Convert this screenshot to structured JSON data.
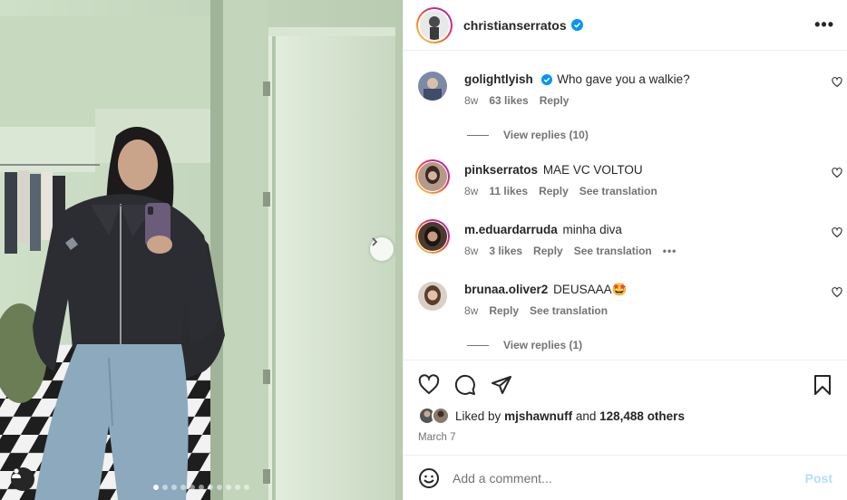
{
  "post": {
    "author": "christianserratos",
    "verified": true,
    "more_label": "•••"
  },
  "comments": [
    {
      "user": "golightlyish",
      "verified": true,
      "text": "Who gave you a walkie?",
      "age": "8w",
      "likes": "63 likes",
      "reply": "Reply",
      "translate": ""
    },
    {
      "user": "pinkserratos",
      "verified": false,
      "text": "MAE VC VOLTOU",
      "age": "8w",
      "likes": "11 likes",
      "reply": "Reply",
      "translate": "See translation"
    },
    {
      "user": "m.eduardarruda",
      "verified": false,
      "text": "minha diva",
      "age": "8w",
      "likes": "3 likes",
      "reply": "Reply",
      "translate": "See translation",
      "options": "•••"
    },
    {
      "user": "brunaa.oliver2",
      "verified": false,
      "text": "DEUSAAA🤩",
      "age": "8w",
      "likes": "",
      "reply": "Reply",
      "translate": "See translation"
    }
  ],
  "replies": [
    {
      "label": "View replies (10)"
    },
    {
      "label": "View replies (1)"
    }
  ],
  "likes": {
    "prefix": "Liked by",
    "user": "mjshawnuff",
    "and": "and",
    "count": "128,488 others"
  },
  "date": "March 7",
  "composer": {
    "placeholder": "Add a comment...",
    "post_label": "Post"
  },
  "icons": [
    "heart-icon",
    "comment-icon",
    "share-icon",
    "bookmark-icon",
    "emoji-icon",
    "chevron-right-icon",
    "user-tag-icon",
    "verified-icon",
    "more-icon"
  ],
  "colors": {
    "accent_disabled": "#b2dffc",
    "verified": "#0095f6",
    "muted": "#737373",
    "text": "#262626"
  },
  "carousel": {
    "slides": 11,
    "active": 0
  }
}
